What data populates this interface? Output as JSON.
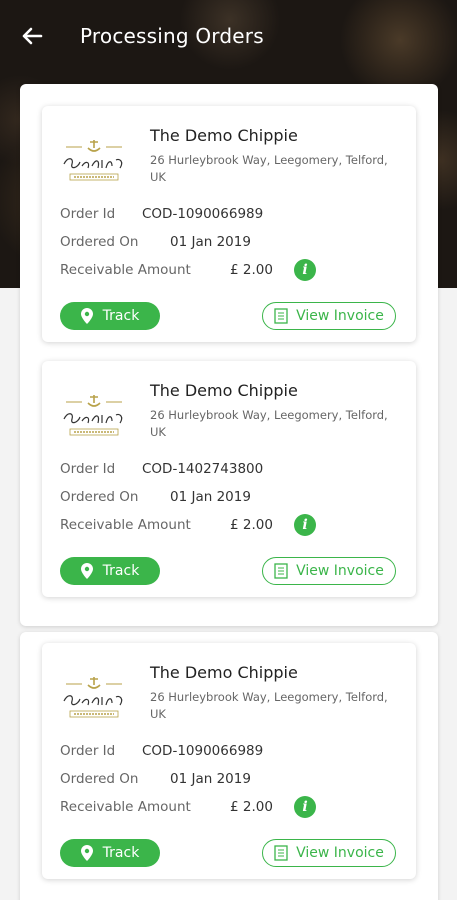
{
  "header": {
    "title": "Processing Orders"
  },
  "colors": {
    "accent": "#3bb54a",
    "header_background": "#1c1713"
  },
  "logo": {
    "alt_text": "The Demo Chippie",
    "tagline": "BEST FISH IN TOWN"
  },
  "orders": [
    {
      "shop_name": "The Demo Chippie",
      "address": "26 Hurleybrook Way, Leegomery, Telford, UK",
      "order_id_label": "Order Id",
      "order_id": "COD-1090066989",
      "ordered_on_label": "Ordered On",
      "ordered_on": "01 Jan 2019",
      "amount_label": "Receivable Amount",
      "amount": "£ 2.00",
      "track_label": "Track",
      "invoice_label": "View Invoice"
    },
    {
      "shop_name": "The Demo Chippie",
      "address": "26 Hurleybrook Way, Leegomery, Telford, UK",
      "order_id_label": "Order Id",
      "order_id": "COD-1402743800",
      "ordered_on_label": "Ordered On",
      "ordered_on": "01 Jan 2019",
      "amount_label": "Receivable Amount",
      "amount": "£ 2.00",
      "track_label": "Track",
      "invoice_label": "View Invoice"
    },
    {
      "shop_name": "The Demo Chippie",
      "address": "26 Hurleybrook Way, Leegomery, Telford, UK",
      "order_id_label": "Order Id",
      "order_id": "COD-1090066989",
      "ordered_on_label": "Ordered On",
      "ordered_on": "01 Jan 2019",
      "amount_label": "Receivable Amount",
      "amount": "£ 2.00",
      "track_label": "Track",
      "invoice_label": "View Invoice"
    }
  ]
}
